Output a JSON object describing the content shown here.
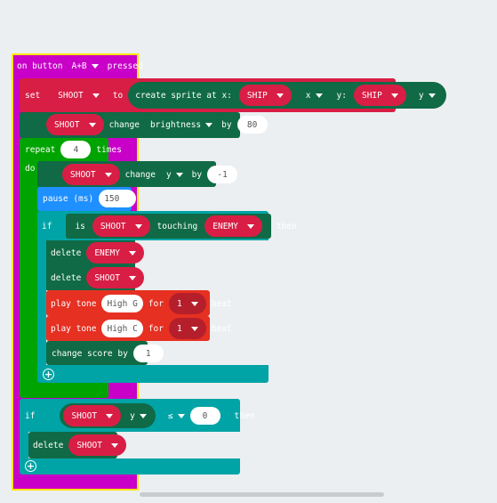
{
  "event": {
    "label_on": "on button",
    "button": "A+B",
    "label_pressed": "pressed"
  },
  "set": {
    "label": "set",
    "var": "SHOOT",
    "to": "to",
    "create": "create sprite at x:",
    "x_sprite": "SHIP",
    "x_prop": "x",
    "y_label": "y:",
    "y_sprite": "SHIP",
    "y_prop": "y"
  },
  "brightness": {
    "sprite": "SHOOT",
    "change": "change",
    "prop": "brightness",
    "by": "by",
    "value": "80"
  },
  "repeat": {
    "label": "repeat",
    "count": "4",
    "times": "times",
    "do": "do"
  },
  "move": {
    "sprite": "SHOOT",
    "change": "change",
    "prop": "y",
    "by": "by",
    "value": "-1"
  },
  "pause": {
    "label": "pause (ms)",
    "value": "150"
  },
  "if1": {
    "if": "if",
    "is": "is",
    "sprite": "SHOOT",
    "touching": "touching",
    "kind": "ENEMY",
    "then": "then"
  },
  "delete1": {
    "label": "delete",
    "target": "ENEMY"
  },
  "delete2": {
    "label": "delete",
    "target": "SHOOT"
  },
  "tone1": {
    "label": "play tone",
    "note": "High G",
    "for": "for",
    "beats": "1",
    "beat": "beat"
  },
  "tone2": {
    "label": "play tone",
    "note": "High C",
    "for": "for",
    "beats": "1",
    "beat": "beat"
  },
  "score": {
    "label": "change score by",
    "value": "1"
  },
  "if2": {
    "if": "if",
    "sprite": "SHOOT",
    "prop": "y",
    "op": "≤",
    "value": "0",
    "then": "then"
  },
  "delete3": {
    "label": "delete",
    "target": "SHOOT"
  },
  "colors": {
    "event": "#c800c8",
    "sprites": "#106a45",
    "variables": "#d81e45",
    "loops": "#00a400",
    "basic": "#1e90ff",
    "logic": "#00a4a6",
    "music": "#e63022"
  }
}
